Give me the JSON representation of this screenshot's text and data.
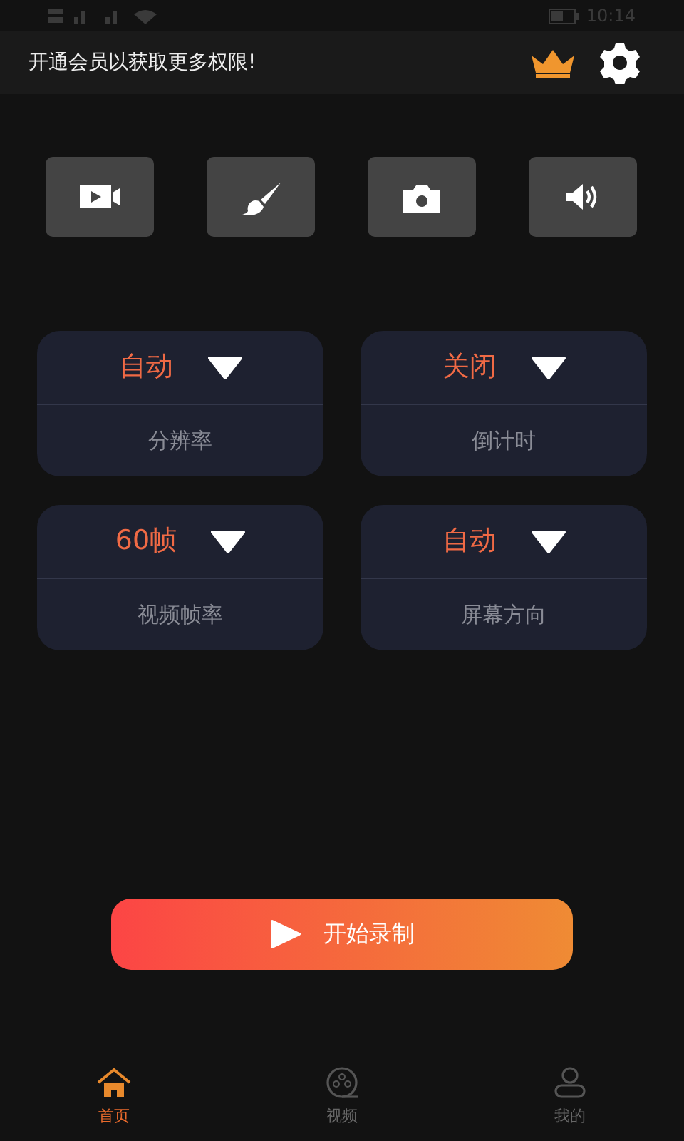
{
  "status_bar": {
    "time": "10:14"
  },
  "header": {
    "promo": "开通会员以获取更多权限!"
  },
  "tools": [
    {
      "kind": "video"
    },
    {
      "kind": "brush"
    },
    {
      "kind": "camera"
    },
    {
      "kind": "sound"
    }
  ],
  "settings": [
    {
      "value": "自动",
      "label": "分辨率"
    },
    {
      "value": "关闭",
      "label": "倒计时"
    },
    {
      "value": "60帧",
      "label": "视频帧率"
    },
    {
      "value": "自动",
      "label": "屏幕方向"
    }
  ],
  "start_button": {
    "label": "开始录制"
  },
  "tab_bar": [
    {
      "kind": "home",
      "label": "首页",
      "selected": true
    },
    {
      "kind": "video",
      "label": "视频",
      "selected": false
    },
    {
      "kind": "profile",
      "label": "我的",
      "selected": false
    }
  ]
}
